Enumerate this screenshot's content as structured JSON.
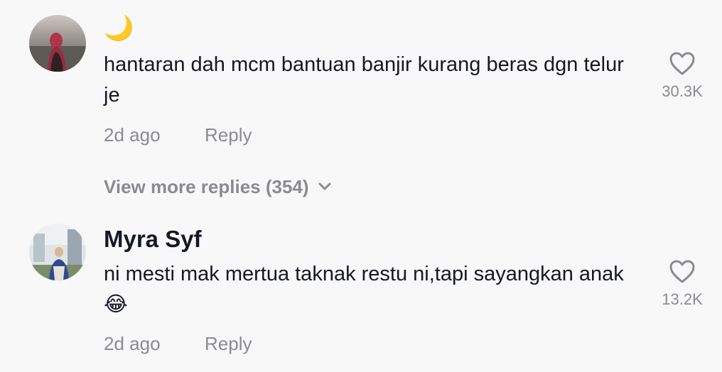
{
  "comments": [
    {
      "username": "🌙",
      "text": "hantaran dah mcm bantuan banjir kurang beras dgn telur je",
      "likes": "30.3K",
      "time": "2d ago",
      "reply_label": "Reply",
      "avatar_icon": "avatar-photo-icon"
    },
    {
      "username": "Myra Syf",
      "text": "ni mesti mak mertua taknak restu ni,tapi sayangkan anak 😂",
      "likes": "13.2K",
      "time": "2d ago",
      "reply_label": "Reply",
      "avatar_icon": "avatar-photo-icon"
    }
  ],
  "view_more": {
    "label": "View more replies (354)",
    "icon": "chevron-down-icon"
  },
  "colors": {
    "background": "#f8f8f8",
    "text": "#161823",
    "muted": "#8a8b91"
  }
}
